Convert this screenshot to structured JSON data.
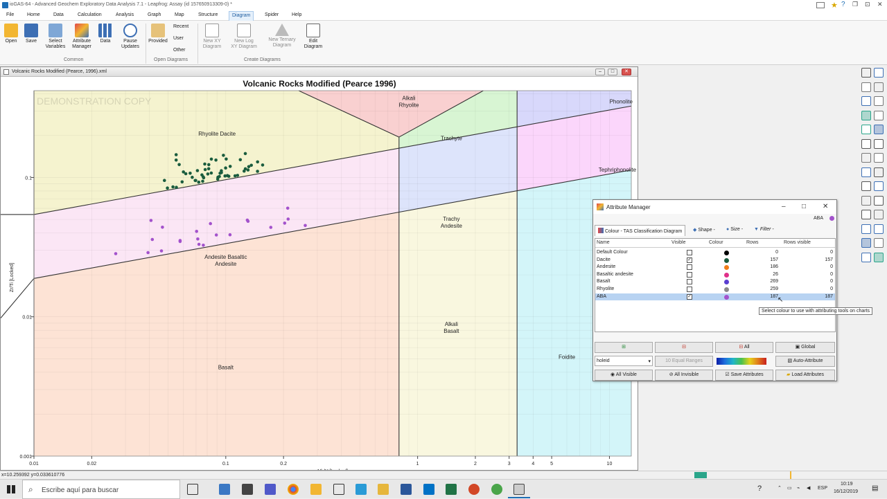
{
  "app": {
    "title": "ioGAS-64 - Advanced Geochem Exploratory Data Analysis 7.1 - Leapfrog: Assay (id 157650913309-0) *"
  },
  "menu": [
    "File",
    "Home",
    "Data",
    "Calculation",
    "Analysis",
    "Graph",
    "Map",
    "Structure",
    "Diagram",
    "Spider",
    "Help"
  ],
  "ribbon": {
    "common": [
      "Open",
      "Save",
      "Select\nVariables",
      "Attribute\nManager",
      "Data",
      "Pause\nUpdates"
    ],
    "common_group": "Common",
    "provided": "Provided",
    "recent": "Recent",
    "user": "User",
    "other": "Other",
    "open_group": "Open Diagrams",
    "create": [
      "New XY\nDiagram",
      "New Log\nXY Diagram",
      "New Ternary\nDiagram",
      "Edit\nDiagram"
    ],
    "create_group": "Create Diagrams"
  },
  "diagram_window": {
    "title": "Volcanic Rocks Modified (Pearce, 1996).xml"
  },
  "chart_data": {
    "type": "scatter",
    "title": "Volcanic Rocks Modified (Pearce 1996)",
    "xlabel": "Nb/Y [Locked]",
    "ylabel": "Zr/Ti [Locked]",
    "x_scale": "log",
    "y_scale": "log",
    "xlim": [
      0.01,
      13
    ],
    "ylim": [
      0.001,
      0.42
    ],
    "x_ticks": [
      {
        "v": 0.01,
        "l": "0.01"
      },
      {
        "v": 0.02,
        "l": "0.02"
      },
      {
        "v": 0.1,
        "l": "0.1"
      },
      {
        "v": 0.2,
        "l": "0.2"
      },
      {
        "v": 1,
        "l": "1"
      },
      {
        "v": 2,
        "l": "2"
      },
      {
        "v": 3,
        "l": "3"
      },
      {
        "v": 4,
        "l": "4"
      },
      {
        "v": 5,
        "l": "5"
      },
      {
        "v": 10,
        "l": "10"
      }
    ],
    "y_ticks": [
      {
        "v": 0.001,
        "l": "0.001"
      },
      {
        "v": 0.01,
        "l": "0.01"
      },
      {
        "v": 0.1,
        "l": "0.1"
      }
    ],
    "watermark": "DEMONSTRATION COPY",
    "regions": [
      {
        "label": "Alkali\nRhyolite",
        "color": "#f9d0d0",
        "label_at": [
          0.9,
          0.36
        ]
      },
      {
        "label": "Rhyolite Dacite",
        "color": "#f5f3cf",
        "label_at": [
          0.09,
          0.2
        ]
      },
      {
        "label": "Trachyte",
        "color": "#d8f5d3",
        "label_at": [
          1.5,
          0.185
        ]
      },
      {
        "label": "Phonolite",
        "color": "#d8d8fb",
        "label_at": [
          11.5,
          0.34
        ]
      },
      {
        "label": "Tephriphonolite",
        "color": "#fbd6fb",
        "label_at": [
          11.0,
          0.11
        ]
      },
      {
        "label": "Trachy\nAndesite",
        "color": "#dde4fb",
        "label_at": [
          1.5,
          0.049
        ]
      },
      {
        "label": "Andesite Basaltic\nAndesite",
        "color": "#fbe6f5",
        "label_at": [
          0.1,
          0.026
        ]
      },
      {
        "label": "Alkali\nBasalt",
        "color": "#f9f7df",
        "label_at": [
          1.5,
          0.0086
        ]
      },
      {
        "label": "Basalt",
        "color": "#fde3d5",
        "label_at": [
          0.1,
          0.0042
        ]
      },
      {
        "label": "Foidite",
        "color": "#d3f5f9",
        "label_at": [
          6.0,
          0.005
        ]
      }
    ],
    "series": [
      {
        "name": "Dacite",
        "color": "#1a5c3e"
      },
      {
        "name": "ABA",
        "color": "#a352cc"
      }
    ]
  },
  "attribute_manager": {
    "title": "Attribute Manager",
    "current": "ABA",
    "tabs": [
      "Colour - TAS Classification Diagram",
      "Shape -",
      "Size -",
      "Filter -"
    ],
    "columns": [
      "Name",
      "Visible",
      "Colour",
      "Rows",
      "Rows visible"
    ],
    "rows": [
      {
        "name": "Default Colour",
        "visible": false,
        "color": "#000000",
        "rows": "0",
        "visible_rows": "0"
      },
      {
        "name": "Dacite",
        "visible": true,
        "color": "#1a5c3e",
        "rows": "157",
        "visible_rows": "157"
      },
      {
        "name": "Andesite",
        "visible": false,
        "color": "#f07d1a",
        "rows": "186",
        "visible_rows": "0"
      },
      {
        "name": "Basaltic andesite",
        "visible": false,
        "color": "#e0308a",
        "rows": "26",
        "visible_rows": "0"
      },
      {
        "name": "Basalt",
        "visible": false,
        "color": "#5a3ed1",
        "rows": "269",
        "visible_rows": "0"
      },
      {
        "name": "Rhyolite",
        "visible": false,
        "color": "#8a8a8a",
        "rows": "259",
        "visible_rows": "0"
      },
      {
        "name": "ABA",
        "visible": true,
        "color": "#a352cc",
        "rows": "187",
        "visible_rows": "187"
      }
    ],
    "buttons": {
      "all": "All",
      "global": "Global",
      "holeid": "holeid",
      "ranges": "10 Equal Ranges",
      "auto": "Auto-Attribute",
      "all_visible": "All Visible",
      "all_invisible": "All Invisible",
      "save": "Save Attributes",
      "load": "Load Attributes"
    },
    "tooltip": "Select colour to use with attributing tools on charts"
  },
  "status": {
    "coords": "x=10.259392 y=0.033610776"
  },
  "taskbar": {
    "search": "Escribe aquí para buscar",
    "lang": "ESP",
    "time": "10:19",
    "date": "16/12/2019"
  }
}
